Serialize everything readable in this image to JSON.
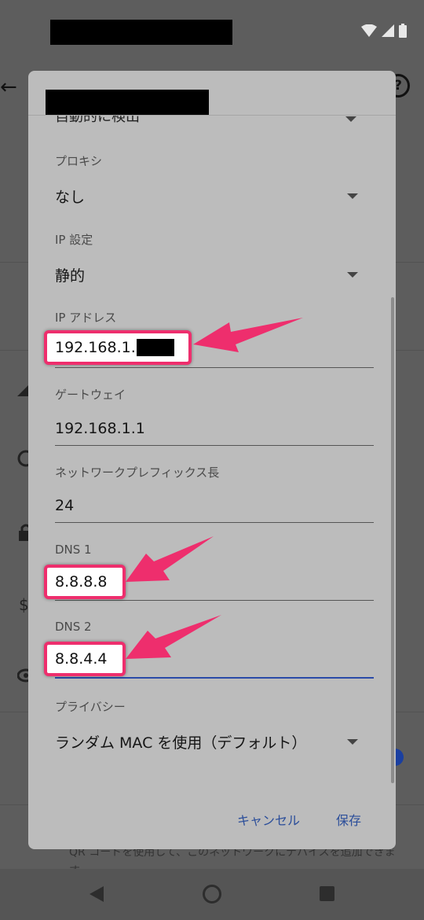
{
  "dialog": {
    "clipped_value": "自動的に検出",
    "proxy": {
      "label": "プロキシ",
      "value": "なし"
    },
    "ip_settings": {
      "label": "IP 設定",
      "value": "静的"
    },
    "ip_address": {
      "label": "IP アドレス",
      "value": "192.168.1."
    },
    "gateway": {
      "label": "ゲートウェイ",
      "value": "192.168.1.1"
    },
    "prefix_length": {
      "label": "ネットワークプレフィックス長",
      "value": "24"
    },
    "dns1": {
      "label": "DNS 1",
      "value": "8.8.8.8"
    },
    "dns2": {
      "label": "DNS 2",
      "value": "8.8.4.4"
    },
    "privacy": {
      "label": "プライバシー",
      "value": "ランダム MAC を使用（デフォルト）"
    },
    "cancel_label": "キャンセル",
    "save_label": "保存"
  },
  "background": {
    "bottom_text": "QR コードを使用して、このネットワークにデバイスを追加できます"
  },
  "colors": {
    "highlight": "#ee2e6d",
    "accent": "#2b4e9a",
    "dialog_bg": "#bcbcbc"
  }
}
